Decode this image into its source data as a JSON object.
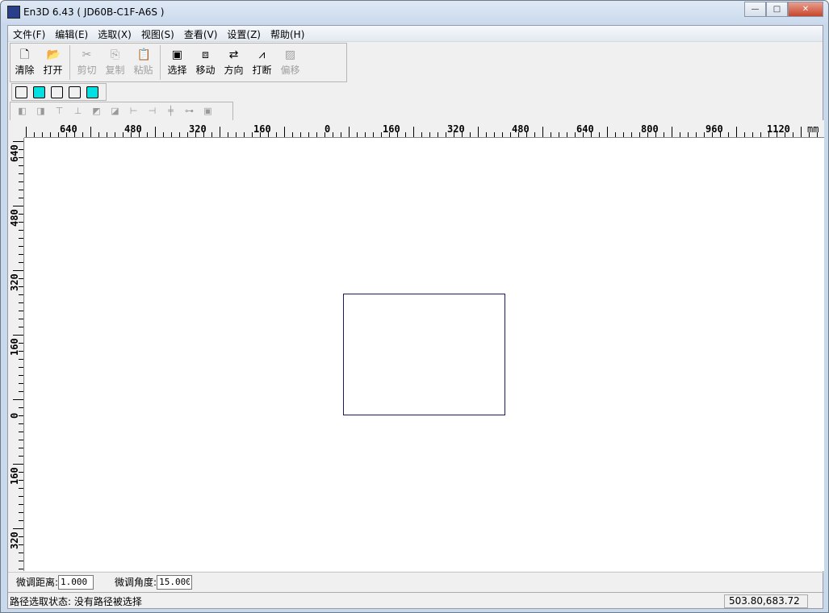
{
  "window": {
    "title": "En3D 6.43 ( JD60B-C1F-A6S )",
    "minimize": "—",
    "maximize": "□",
    "close": "✕"
  },
  "menu": [
    "文件(F)",
    "编辑(E)",
    "选取(X)",
    "视图(S)",
    "查看(V)",
    "设置(Z)",
    "帮助(H)"
  ],
  "toolbar": [
    {
      "label": "清除",
      "icon": "new-file-icon",
      "glyph": "🗋",
      "enabled": true
    },
    {
      "label": "打开",
      "icon": "open-folder-icon",
      "glyph": "📂",
      "enabled": true
    },
    {
      "sep": true
    },
    {
      "label": "剪切",
      "icon": "cut-icon",
      "glyph": "✂",
      "enabled": false
    },
    {
      "label": "复制",
      "icon": "copy-icon",
      "glyph": "⎘",
      "enabled": false
    },
    {
      "label": "粘贴",
      "icon": "paste-icon",
      "glyph": "📋",
      "enabled": false
    },
    {
      "sep": true
    },
    {
      "label": "选择",
      "icon": "select-icon",
      "glyph": "▣",
      "enabled": true
    },
    {
      "label": "移动",
      "icon": "move-icon",
      "glyph": "⧈",
      "enabled": true
    },
    {
      "label": "方向",
      "icon": "direction-icon",
      "glyph": "⇄",
      "enabled": true
    },
    {
      "label": "打断",
      "icon": "break-icon",
      "glyph": "⩘",
      "enabled": true
    },
    {
      "label": "偏移",
      "icon": "offset-icon",
      "glyph": "▨",
      "enabled": false
    }
  ],
  "view_cubes": [
    false,
    true,
    false,
    false,
    true
  ],
  "align_tools": [
    "◧",
    "◨",
    "⊤",
    "⊥",
    "◩",
    "◪",
    "⊢",
    "⊣",
    "╪",
    "⊶",
    "▣"
  ],
  "ruler": {
    "unit": "mm",
    "h_labels": [
      "640",
      "480",
      "320",
      "160",
      "0",
      "160",
      "320",
      "480",
      "640",
      "800",
      "960",
      "1120"
    ],
    "v_labels": [
      "640",
      "480",
      "320",
      "160",
      "0",
      "160",
      "320"
    ]
  },
  "bottom": {
    "dist_label": "微调距离:",
    "dist_value": "1.000",
    "angle_label": "微调角度:",
    "angle_value": "15.000"
  },
  "status": {
    "text": "路径选取状态: 没有路径被选择",
    "coords": "503.80,683.72"
  }
}
